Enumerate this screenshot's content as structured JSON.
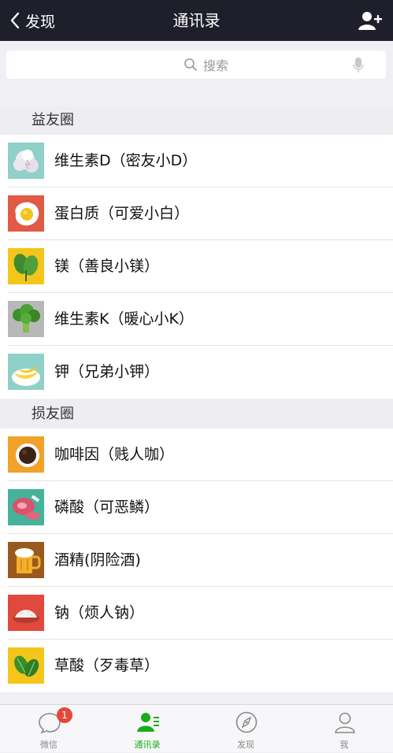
{
  "nav": {
    "back_label": "发现",
    "title": "通讯录"
  },
  "search": {
    "placeholder": "搜索"
  },
  "sections": [
    {
      "header": "益友圈",
      "items": [
        {
          "name": "维生素D（密友小D）"
        },
        {
          "name": "蛋白质（可爱小白）"
        },
        {
          "name": "镁（善良小镁）"
        },
        {
          "name": "维生素K（暖心小K）"
        },
        {
          "name": "钾（兄弟小钾）"
        }
      ]
    },
    {
      "header": "损友圈",
      "items": [
        {
          "name": "咖啡因（贱人咖）"
        },
        {
          "name": "磷酸（可恶鳞）"
        },
        {
          "name": "酒精(阴险酒)"
        },
        {
          "name": "钠（烦人钠）"
        },
        {
          "name": "草酸（歹毒草）"
        }
      ]
    }
  ],
  "tabbar": {
    "tabs": [
      {
        "label": "微信",
        "badge": "1"
      },
      {
        "label": "通讯录"
      },
      {
        "label": "发现"
      },
      {
        "label": "我"
      }
    ]
  },
  "colors": {
    "nav_bg": "#1e1f2a",
    "accent_green": "#1aad19",
    "badge_red": "#e5483a"
  }
}
